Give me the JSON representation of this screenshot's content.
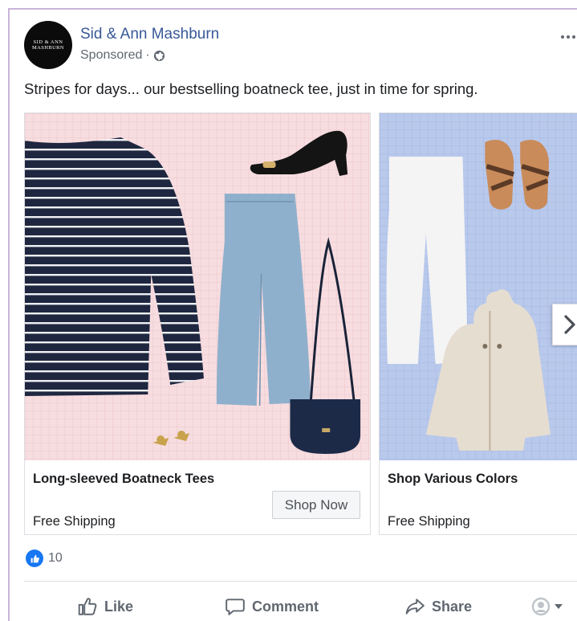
{
  "post": {
    "page_name": "Sid & Ann Mashburn",
    "avatar_line1": "SID & ANN",
    "avatar_line2": "MASHBURN",
    "sponsored": "Sponsored",
    "separator": "·",
    "privacy_icon": "globe-icon",
    "caption": "Stripes for days... our bestselling boatneck tee, just in time for spring."
  },
  "carousel": {
    "cards": [
      {
        "title": "Long-sleeved Boatneck Tees",
        "subtitle": "Free Shipping",
        "cta": "Shop Now",
        "bg_color": "#f7dde0"
      },
      {
        "title": "Shop Various Colors",
        "subtitle": "Free Shipping",
        "bg_color": "#b9c9ec"
      }
    ],
    "next_icon": "chevron-right-icon"
  },
  "reactions": {
    "icon": "like-icon",
    "count": "10"
  },
  "actions": {
    "like": "Like",
    "comment": "Comment",
    "share": "Share"
  },
  "colors": {
    "brand_link": "#385898",
    "like_blue": "#1877f2",
    "muted": "#606770"
  }
}
